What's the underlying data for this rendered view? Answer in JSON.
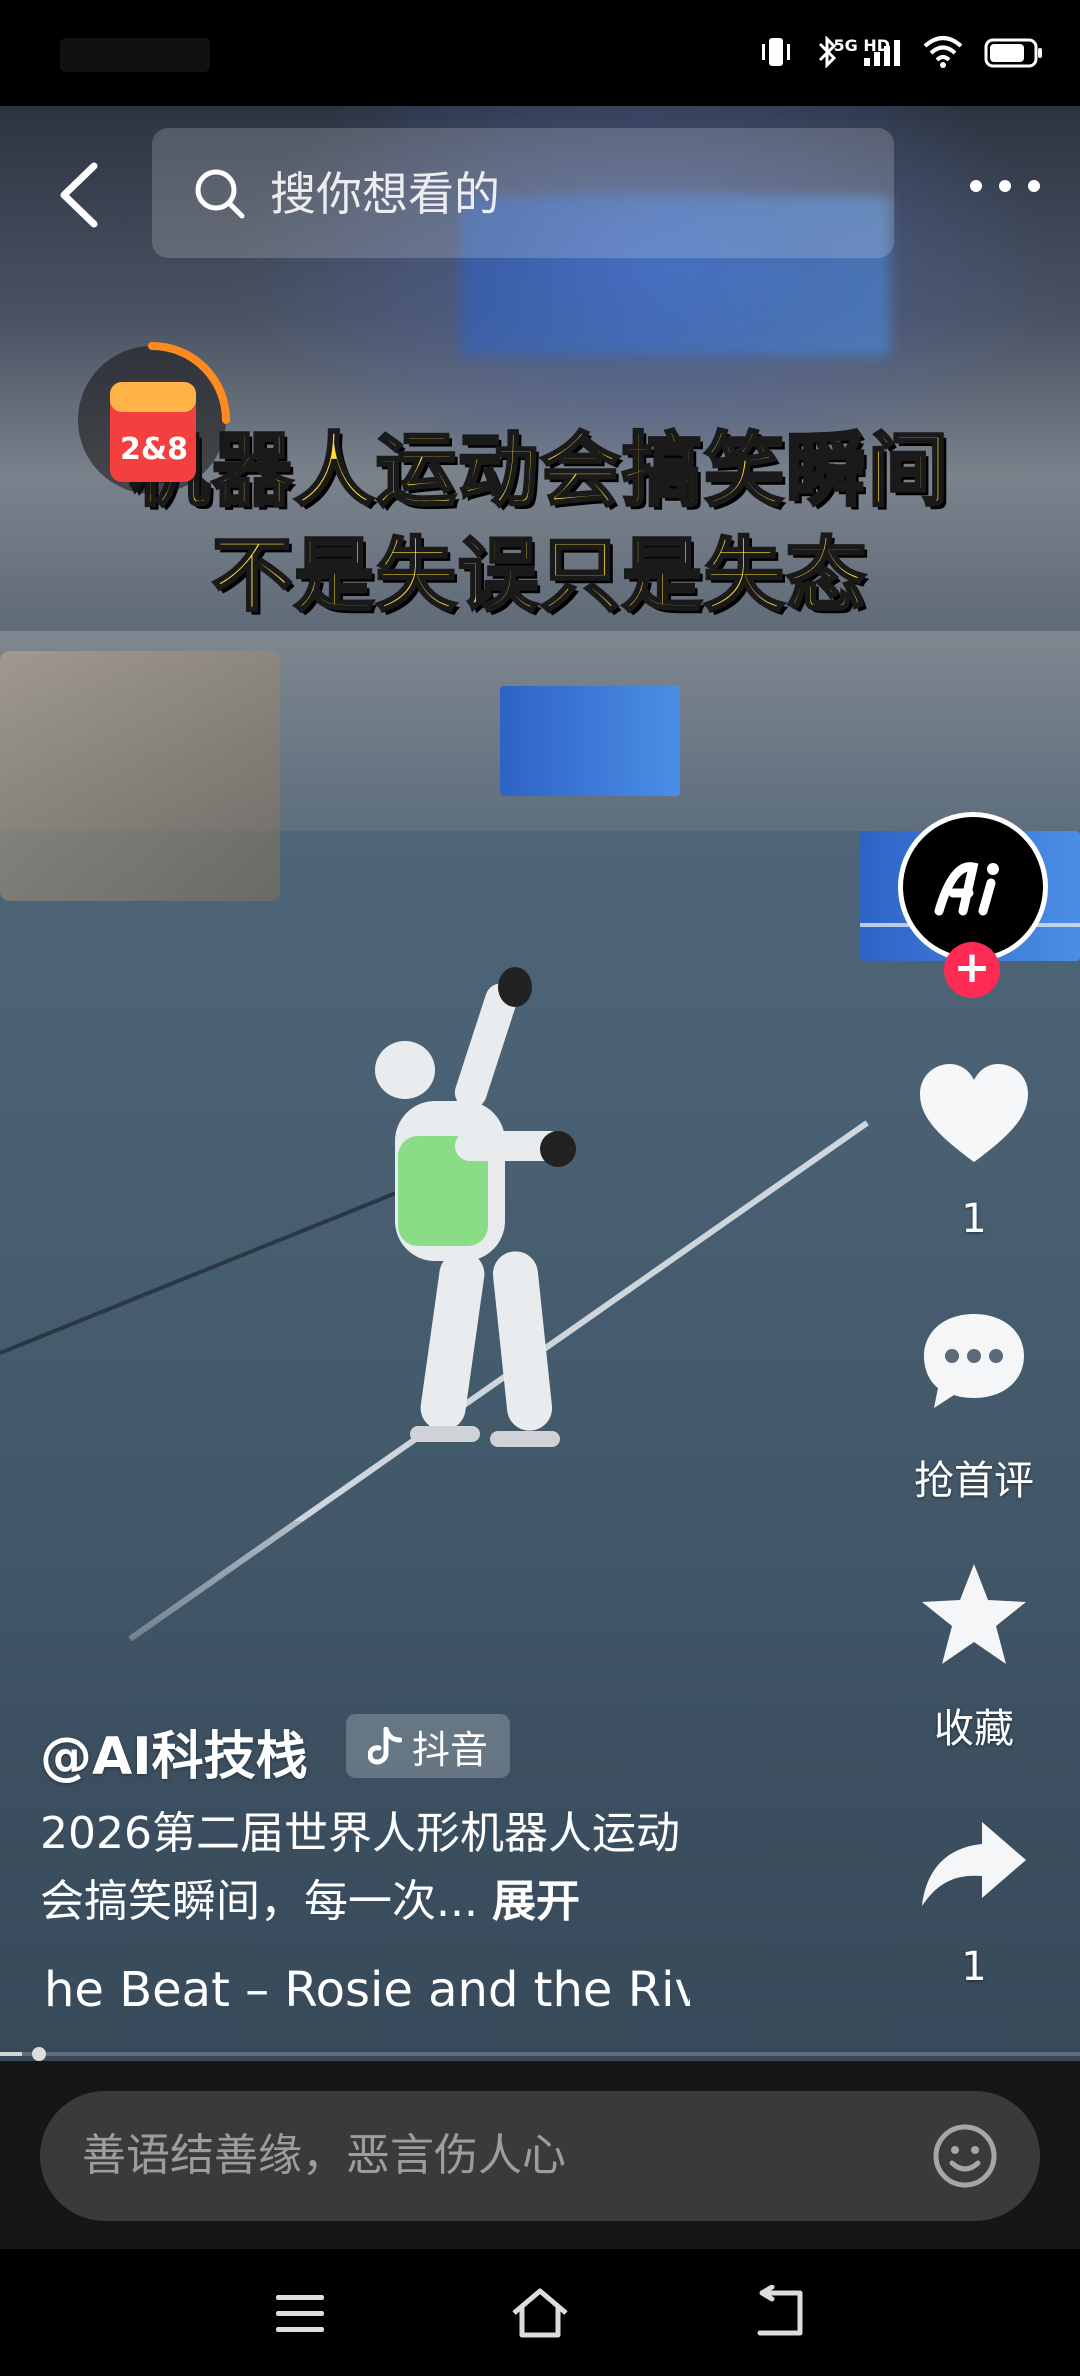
{
  "status_bar": {
    "network_label": "5G HD"
  },
  "top_bar": {
    "search_placeholder": "搜你想看的"
  },
  "video": {
    "caption_line1": "机器人运动会搞笑瞬间",
    "caption_line2": "不是失误只是失态",
    "packet_label": "2&8"
  },
  "right_rail": {
    "like_count": "1",
    "comment_label": "抢首评",
    "favorite_label": "收藏",
    "share_count": "1"
  },
  "info": {
    "author": "@AI科技栈",
    "platform_tag": "抖音",
    "description": "2026第二届世界人形机器人运动会搞笑瞬间，每一次...",
    "expand_label": "展开",
    "music": "he Beat – Rosie and the Riv"
  },
  "progress": {
    "fraction": 0.02
  },
  "comment_bar": {
    "placeholder": "善语结善缘，恶言伤人心"
  },
  "colors": {
    "caption": "#ffe03a",
    "follow": "#fe2c55"
  }
}
